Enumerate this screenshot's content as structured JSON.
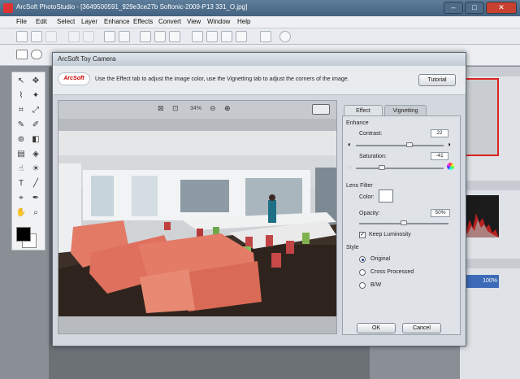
{
  "app": {
    "title": "ArcSoft PhotoStudio - [3649500591_929e3ce27b Softonic-2009-P13 331_O.jpg]",
    "window_buttons": [
      "–",
      "□",
      "✕"
    ],
    "menu": [
      "File",
      "Edit",
      "Select",
      "Layer",
      "Enhance",
      "Effects",
      "Convert",
      "View",
      "Window",
      "Help"
    ]
  },
  "panels": {
    "layer_opacity": "100%"
  },
  "dialog": {
    "title": "ArcSoft Toy Camera",
    "logo": "ArcSoft",
    "description": "Use the Effect tab to adjust the image color, use the Vignetting tab to adjust the corners of the image.",
    "tutorial_label": "Tutorial",
    "zoom": "34%",
    "tabs": [
      "Effect",
      "Vignetting"
    ],
    "enhance": {
      "group_label": "Enhance",
      "contrast_label": "Contrast:",
      "contrast_value": "22",
      "contrast_level": 0.22,
      "saturation_label": "Saturation:",
      "saturation_value": "-41",
      "saturation_level": -0.41
    },
    "lens_filter": {
      "group_label": "Lens Filter",
      "color_label": "Color:",
      "color_value": "#ffffff",
      "opacity_label": "Opacity:",
      "opacity_value": "50%",
      "opacity_level": 0.5,
      "keep_luminosity_label": "Keep Luminosity",
      "keep_luminosity_checked": true
    },
    "style": {
      "group_label": "Style",
      "options": [
        "Original",
        "Cross Processed",
        "B/W"
      ],
      "selected": "Original"
    },
    "ok_label": "OK",
    "cancel_label": "Cancel"
  }
}
